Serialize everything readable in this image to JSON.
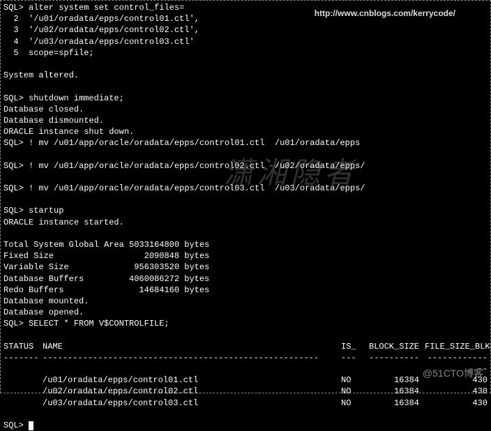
{
  "url": "http://www.cnblogs.com/kerrycode/",
  "watermark": "潇湘隐者",
  "bottom_mark": "@51CTO博客",
  "lines": {
    "l1": "SQL> alter system set control_files=",
    "l2": "  2  '/u01/oradata/epps/control01.ctl',",
    "l3": "  3  '/u02/oradata/epps/control02.ctl',",
    "l4": "  4  '/u03/oradata/epps/control03.ctl'",
    "l5": "  5  scope=spfile;",
    "l6": " ",
    "l7": "System altered.",
    "l8": " ",
    "l9": "SQL> shutdown immediate;",
    "l10": "Database closed.",
    "l11": "Database dismounted.",
    "l12": "ORACLE instance shut down.",
    "l13": "SQL> ! mv /u01/app/oracle/oradata/epps/control01.ctl  /u01/oradata/epps",
    "l14": " ",
    "l15": "SQL> ! mv /u01/app/oracle/oradata/epps/control02.ctl  /u02/oradata/epps/",
    "l16": " ",
    "l17": "SQL> ! mv /u01/app/oracle/oradata/epps/control03.ctl  /u03/oradata/epps/",
    "l18": " ",
    "l19": "SQL> startup",
    "l20": "ORACLE instance started.",
    "l21": " ",
    "l22": "Total System Global Area 5033164800 bytes",
    "l23": "Fixed Size                  2090848 bytes",
    "l24": "Variable Size             956303520 bytes",
    "l25": "Database Buffers         4060086272 bytes",
    "l26": "Redo Buffers               14684160 bytes",
    "l27": "Database mounted.",
    "l28": "Database opened.",
    "l29": "SQL> SELECT * FROM V$CONTROLFILE;",
    "l30": " "
  },
  "table": {
    "headers": {
      "status": "STATUS",
      "name": "NAME",
      "is": "IS_",
      "bs": "BLOCK_SIZE",
      "fs": "FILE_SIZE_BLKS"
    },
    "dash": {
      "status": "-------",
      "name": "-------------------------------------------------------",
      "is": "---",
      "bs": "----------",
      "fs": "--------------"
    },
    "rows": [
      {
        "status": "",
        "name": "/u01/oradata/epps/control01.ctl",
        "is": "NO",
        "bs": "16384",
        "fs": "430"
      },
      {
        "status": "",
        "name": "/u02/oradata/epps/control02.ctl",
        "is": "NO",
        "bs": "16384",
        "fs": "430"
      },
      {
        "status": "",
        "name": "/u03/oradata/epps/control03.ctl",
        "is": "NO",
        "bs": "16384",
        "fs": "430"
      }
    ]
  },
  "prompt": "SQL> "
}
